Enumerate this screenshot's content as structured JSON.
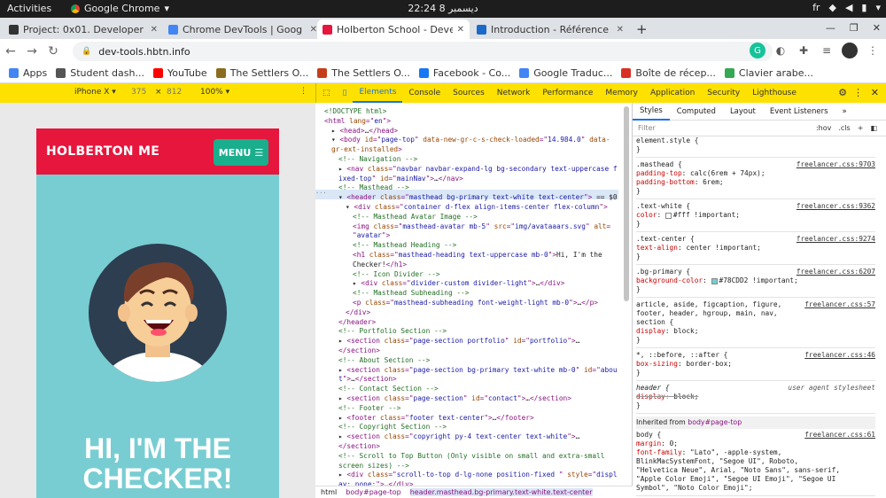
{
  "gnome": {
    "activities": "Activities",
    "app_name": "Google Chrome",
    "clock": "22:24  8 ديسمبر",
    "lang": "fr"
  },
  "tabs": [
    {
      "title": "Project: 0x01. Developer t",
      "color": "#333333"
    },
    {
      "title": "Chrome DevTools | Goog",
      "color": "#4285f4"
    },
    {
      "title": "Holberton School - Develo",
      "color": "#e6163d"
    },
    {
      "title": "Introduction - Référence",
      "color": "#1b6ac9"
    }
  ],
  "new_tab": "+",
  "address": {
    "url": "dev-tools.hbtn.info"
  },
  "bookmarks": [
    {
      "label": "Apps",
      "color": "#4285f4"
    },
    {
      "label": "Student dash...",
      "color": "#555555"
    },
    {
      "label": "YouTube",
      "color": "#ff0000"
    },
    {
      "label": "The Settlers O...",
      "color": "#8a6d1e"
    },
    {
      "label": "The Settlers O...",
      "color": "#c43e1c"
    },
    {
      "label": "Facebook - Co...",
      "color": "#1877f2"
    },
    {
      "label": "Google Traduc...",
      "color": "#4285f4"
    },
    {
      "label": "Boîte de récep...",
      "color": "#d93025"
    },
    {
      "label": "Clavier arabe...",
      "color": "#34a853"
    }
  ],
  "device": {
    "model": "iPhone X",
    "width": "375",
    "x": "×",
    "height": "812",
    "zoom": "100%"
  },
  "devtools_tabs": [
    "Elements",
    "Console",
    "Sources",
    "Network",
    "Performance",
    "Memory",
    "Application",
    "Security",
    "Lighthouse"
  ],
  "page": {
    "brand": "HOLBERTON ME",
    "menu": "MENU",
    "hero_line1": "HI, I'M THE",
    "hero_line2": "CHECKER!"
  },
  "elements": [
    {
      "d": 0,
      "segs": [
        [
          "cm",
          "<!DOCTYPE html>"
        ]
      ]
    },
    {
      "d": 0,
      "segs": [
        [
          "tg",
          "<html "
        ],
        [
          "at",
          "lang"
        ],
        [
          "tg",
          "=\""
        ],
        [
          "av",
          "en"
        ],
        [
          "tg",
          "\">"
        ]
      ]
    },
    {
      "d": 1,
      "segs": [
        [
          "tx",
          "▸ "
        ],
        [
          "tg",
          "<head>"
        ],
        [
          "tx",
          "…"
        ],
        [
          "tg",
          "</head>"
        ]
      ]
    },
    {
      "d": 1,
      "segs": [
        [
          "tx",
          "▾ "
        ],
        [
          "tg",
          "<body "
        ],
        [
          "at",
          "id"
        ],
        [
          "tg",
          "=\""
        ],
        [
          "av",
          "page-top"
        ],
        [
          "tg",
          "\" "
        ],
        [
          "at",
          "data-new-gr-c-s-check-loaded"
        ],
        [
          "tg",
          "=\""
        ],
        [
          "av",
          "14.984.0"
        ],
        [
          "tg",
          "\" "
        ],
        [
          "at",
          "data-"
        ]
      ]
    },
    {
      "d": 1,
      "segs": [
        [
          "at",
          "gr-ext-installed"
        ],
        [
          "tg",
          ">"
        ]
      ]
    },
    {
      "d": 2,
      "segs": [
        [
          "cm",
          "<!-- Navigation -->"
        ]
      ]
    },
    {
      "d": 2,
      "segs": [
        [
          "tx",
          "▸ "
        ],
        [
          "tg",
          "<nav "
        ],
        [
          "at",
          "class"
        ],
        [
          "tg",
          "=\""
        ],
        [
          "av",
          "navbar navbar-expand-lg bg-secondary text-uppercase f"
        ]
      ]
    },
    {
      "d": 2,
      "segs": [
        [
          "av",
          "ixed-top"
        ],
        [
          "tg",
          "\" "
        ],
        [
          "at",
          "id"
        ],
        [
          "tg",
          "=\""
        ],
        [
          "av",
          "mainNav"
        ],
        [
          "tg",
          "\">"
        ],
        [
          "tx",
          "…"
        ],
        [
          "tg",
          "</nav>"
        ]
      ]
    },
    {
      "d": 2,
      "segs": [
        [
          "cm",
          "<!-- Masthead -->"
        ]
      ]
    },
    {
      "d": 2,
      "segs": [
        [
          "tx",
          "▾ "
        ],
        [
          "tg",
          "<header "
        ],
        [
          "at",
          "class"
        ],
        [
          "tg",
          "=\""
        ],
        [
          "av",
          "masthead bg-primary text-white text-center"
        ],
        [
          "tg",
          "\">"
        ],
        [
          "tx",
          " == $0"
        ]
      ]
    },
    {
      "d": 3,
      "segs": [
        [
          "tx",
          "▾ "
        ],
        [
          "tg",
          "<div "
        ],
        [
          "at",
          "class"
        ],
        [
          "tg",
          "=\""
        ],
        [
          "av",
          "container d-flex align-items-center flex-column"
        ],
        [
          "tg",
          "\">"
        ]
      ]
    },
    {
      "d": 4,
      "segs": [
        [
          "cm",
          "<!-- Masthead Avatar Image -->"
        ]
      ]
    },
    {
      "d": 4,
      "segs": [
        [
          "tg",
          "<img "
        ],
        [
          "at",
          "class"
        ],
        [
          "tg",
          "=\""
        ],
        [
          "av",
          "masthead-avatar mb-5"
        ],
        [
          "tg",
          "\" "
        ],
        [
          "at",
          "src"
        ],
        [
          "tg",
          "=\""
        ],
        [
          "av",
          "img/avataaars.svg"
        ],
        [
          "tg",
          "\" "
        ],
        [
          "at",
          "alt"
        ],
        [
          "tg",
          "="
        ]
      ]
    },
    {
      "d": 4,
      "segs": [
        [
          "tg",
          "\""
        ],
        [
          "av",
          "avatar"
        ],
        [
          "tg",
          "\">"
        ]
      ]
    },
    {
      "d": 4,
      "segs": [
        [
          "cm",
          "<!-- Masthead Heading -->"
        ]
      ]
    },
    {
      "d": 4,
      "segs": [
        [
          "tg",
          "<h1 "
        ],
        [
          "at",
          "class"
        ],
        [
          "tg",
          "=\""
        ],
        [
          "av",
          "masthead-heading text-uppercase mb-0"
        ],
        [
          "tg",
          "\">"
        ],
        [
          "tx",
          "Hi, I'm the"
        ]
      ]
    },
    {
      "d": 4,
      "segs": [
        [
          "tx",
          "Checker!"
        ],
        [
          "tg",
          "</h1>"
        ]
      ]
    },
    {
      "d": 4,
      "segs": [
        [
          "cm",
          "<!-- Icon Divider -->"
        ]
      ]
    },
    {
      "d": 4,
      "segs": [
        [
          "tx",
          "▸ "
        ],
        [
          "tg",
          "<div "
        ],
        [
          "at",
          "class"
        ],
        [
          "tg",
          "=\""
        ],
        [
          "av",
          "divider-custom divider-light"
        ],
        [
          "tg",
          "\">"
        ],
        [
          "tx",
          "…"
        ],
        [
          "tg",
          "</div>"
        ]
      ]
    },
    {
      "d": 4,
      "segs": [
        [
          "cm",
          "<!-- Masthead Subheading -->"
        ]
      ]
    },
    {
      "d": 4,
      "segs": [
        [
          "tg",
          "<p "
        ],
        [
          "at",
          "class"
        ],
        [
          "tg",
          "=\""
        ],
        [
          "av",
          "masthead-subheading font-weight-light mb-0"
        ],
        [
          "tg",
          "\">"
        ],
        [
          "tx",
          "…"
        ],
        [
          "tg",
          "</p>"
        ]
      ]
    },
    {
      "d": 3,
      "segs": [
        [
          "tg",
          "</div>"
        ]
      ]
    },
    {
      "d": 2,
      "segs": [
        [
          "tg",
          "</header>"
        ]
      ]
    },
    {
      "d": 2,
      "segs": [
        [
          "cm",
          "<!-- Portfolio Section -->"
        ]
      ]
    },
    {
      "d": 2,
      "segs": [
        [
          "tx",
          "▸ "
        ],
        [
          "tg",
          "<section "
        ],
        [
          "at",
          "class"
        ],
        [
          "tg",
          "=\""
        ],
        [
          "av",
          "page-section portfolio"
        ],
        [
          "tg",
          "\" "
        ],
        [
          "at",
          "id"
        ],
        [
          "tg",
          "=\""
        ],
        [
          "av",
          "portfolio"
        ],
        [
          "tg",
          "\">"
        ],
        [
          "tx",
          "…"
        ]
      ]
    },
    {
      "d": 2,
      "segs": [
        [
          "tg",
          "</section>"
        ]
      ]
    },
    {
      "d": 2,
      "segs": [
        [
          "cm",
          "<!-- About Section -->"
        ]
      ]
    },
    {
      "d": 2,
      "segs": [
        [
          "tx",
          "▸ "
        ],
        [
          "tg",
          "<section "
        ],
        [
          "at",
          "class"
        ],
        [
          "tg",
          "=\""
        ],
        [
          "av",
          "page-section bg-primary text-white mb-0"
        ],
        [
          "tg",
          "\" "
        ],
        [
          "at",
          "id"
        ],
        [
          "tg",
          "=\""
        ],
        [
          "av",
          "abou"
        ]
      ]
    },
    {
      "d": 2,
      "segs": [
        [
          "av",
          "t"
        ],
        [
          "tg",
          "\">"
        ],
        [
          "tx",
          "…"
        ],
        [
          "tg",
          "</section>"
        ]
      ]
    },
    {
      "d": 2,
      "segs": [
        [
          "cm",
          "<!-- Contact Section -->"
        ]
      ]
    },
    {
      "d": 2,
      "segs": [
        [
          "tx",
          "▸ "
        ],
        [
          "tg",
          "<section "
        ],
        [
          "at",
          "class"
        ],
        [
          "tg",
          "=\""
        ],
        [
          "av",
          "page-section"
        ],
        [
          "tg",
          "\" "
        ],
        [
          "at",
          "id"
        ],
        [
          "tg",
          "=\""
        ],
        [
          "av",
          "contact"
        ],
        [
          "tg",
          "\">"
        ],
        [
          "tx",
          "…"
        ],
        [
          "tg",
          "</section>"
        ]
      ]
    },
    {
      "d": 2,
      "segs": [
        [
          "cm",
          "<!-- Footer -->"
        ]
      ]
    },
    {
      "d": 2,
      "segs": [
        [
          "tx",
          "▸ "
        ],
        [
          "tg",
          "<footer "
        ],
        [
          "at",
          "class"
        ],
        [
          "tg",
          "=\""
        ],
        [
          "av",
          "footer text-center"
        ],
        [
          "tg",
          "\">"
        ],
        [
          "tx",
          "…"
        ],
        [
          "tg",
          "</footer>"
        ]
      ]
    },
    {
      "d": 2,
      "segs": [
        [
          "cm",
          "<!-- Copyright Section -->"
        ]
      ]
    },
    {
      "d": 2,
      "segs": [
        [
          "tx",
          "▸ "
        ],
        [
          "tg",
          "<section "
        ],
        [
          "at",
          "class"
        ],
        [
          "tg",
          "=\""
        ],
        [
          "av",
          "copyright py-4 text-center text-white"
        ],
        [
          "tg",
          "\">"
        ],
        [
          "tx",
          "…"
        ]
      ]
    },
    {
      "d": 2,
      "segs": [
        [
          "tg",
          "</section>"
        ]
      ]
    },
    {
      "d": 2,
      "segs": [
        [
          "cm",
          "<!-- Scroll to Top Button (Only visible on small and extra-small"
        ]
      ]
    },
    {
      "d": 2,
      "segs": [
        [
          "cm",
          "screen sizes) -->"
        ]
      ]
    },
    {
      "d": 2,
      "segs": [
        [
          "tx",
          "▸ "
        ],
        [
          "tg",
          "<div "
        ],
        [
          "at",
          "class"
        ],
        [
          "tg",
          "=\""
        ],
        [
          "av",
          "scroll-to-top d-lg-none position-fixed "
        ],
        [
          "tg",
          "\" "
        ],
        [
          "at",
          "style"
        ],
        [
          "tg",
          "=\""
        ],
        [
          "av",
          "displ"
        ]
      ]
    },
    {
      "d": 2,
      "segs": [
        [
          "av",
          "ay: none;"
        ],
        [
          "tg",
          "\">"
        ],
        [
          "tx",
          "…"
        ],
        [
          "tg",
          "</div>"
        ]
      ]
    }
  ],
  "breadcrumb": [
    "html",
    "body#page-top",
    "header.masthead.bg-primary.text-white.text-center"
  ],
  "styles_tabs": [
    "Styles",
    "Computed",
    "Layout",
    "Event Listeners"
  ],
  "filter": {
    "placeholder": "Filter",
    "hov": ":hov",
    "cls": ".cls"
  },
  "inherited_label": "Inherited from",
  "inherited_from": "body#page-top",
  "rules": [
    {
      "lines": [
        [
          "element.style {"
        ],
        [
          "}"
        ]
      ]
    },
    {
      "src": "freelancer.css:9703",
      "lines": [
        [
          ".masthead {"
        ],
        [
          "  padding-top",
          "calc(6rem + 74px);"
        ],
        [
          "  padding-bottom",
          "6rem;"
        ],
        [
          "}"
        ]
      ]
    },
    {
      "src": "freelancer.css:9362",
      "lines": [
        [
          ".text-white {"
        ],
        [
          "  color",
          "#fff !important;",
          "#ffffff"
        ],
        [
          "}"
        ]
      ]
    },
    {
      "src": "freelancer.css:9274",
      "lines": [
        [
          ".text-center {"
        ],
        [
          "  text-align",
          "center !important;"
        ],
        [
          "}"
        ]
      ]
    },
    {
      "src": "freelancer.css:6207",
      "lines": [
        [
          ".bg-primary {"
        ],
        [
          "  background-color",
          "#78CDD2 !important;",
          "#78cdd2"
        ],
        [
          "}"
        ]
      ]
    },
    {
      "src": "freelancer.css:57",
      "lines": [
        [
          "article, aside, figcaption, figure,"
        ],
        [
          "footer, header, hgroup, main, nav,"
        ],
        [
          "section {"
        ],
        [
          "  display",
          "block;"
        ],
        [
          "}"
        ]
      ]
    },
    {
      "src": "freelancer.css:46",
      "lines": [
        [
          "*, ::before, ::after {"
        ],
        [
          "  box-sizing",
          "border-box;"
        ],
        [
          "}"
        ]
      ]
    },
    {
      "src": "user agent stylesheet",
      "lines": [
        [
          "header {"
        ],
        [
          "  display",
          "block;",
          "",
          "strike"
        ],
        [
          "}"
        ]
      ]
    }
  ],
  "inherited_rules": [
    {
      "src": "freelancer.css:61",
      "lines": [
        [
          "body {"
        ],
        [
          "  margin",
          "0;"
        ],
        [
          "  font-family",
          "\"Lato\", -apple-system,"
        ],
        [
          "    BlinkMacSystemFont, \"Segoe UI\", Roboto,"
        ],
        [
          "    \"Helvetica Neue\", Arial, \"Noto Sans\", sans-serif,"
        ],
        [
          "    \"Apple Color Emoji\", \"Segoe UI Emoji\", \"Segoe UI"
        ],
        [
          "    Symbol\", \"Noto Color Emoji\";"
        ]
      ]
    }
  ]
}
